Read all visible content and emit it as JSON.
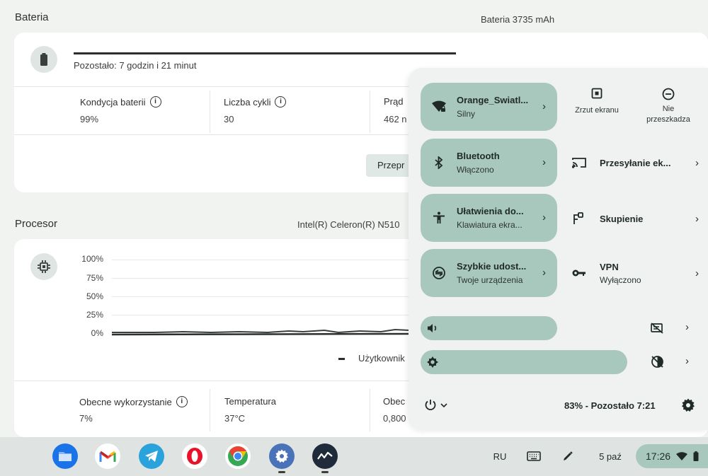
{
  "battery": {
    "title": "Bateria",
    "capacity": "Bateria 3735 mAh",
    "remaining": "Pozostało: 7 godzin i 21 minut",
    "health_label": "Kondycja baterii",
    "health_value": "99%",
    "cycles_label": "Liczba cykli",
    "cycles_value": "30",
    "current_label": "Prąd",
    "current_value": "462 n",
    "button_label": "Przepr"
  },
  "processor": {
    "title": "Procesor",
    "model": "Intel(R) Celeron(R) N510",
    "y_ticks": [
      "100%",
      "75%",
      "50%",
      "25%",
      "0%"
    ],
    "legend_user": "Użytkownik",
    "usage_label": "Obecne wykorzystanie",
    "usage_value": "7%",
    "temp_label": "Temperatura",
    "temp_value": "37°C",
    "freq_label": "Obec",
    "freq_value": "0,800"
  },
  "quick_settings": {
    "wifi": {
      "name": "Orange_Swiatl...",
      "status": "Silny"
    },
    "bluetooth": {
      "name": "Bluetooth",
      "status": "Włączono"
    },
    "accessibility": {
      "name": "Ułatwienia do...",
      "status": "Klawiatura ekra..."
    },
    "nearby": {
      "name": "Szybkie udost...",
      "status": "Twoje urządzenia"
    },
    "screenshot_label": "Zrzut ekranu",
    "dnd_label": "Nie przeszkadza",
    "cast_label": "Przesyłanie ek...",
    "focus_label": "Skupienie",
    "vpn": {
      "name": "VPN",
      "status": "Wyłączono"
    },
    "battery_status": "83% - Pozostało 7:21"
  },
  "shelf": {
    "apps": [
      "files",
      "gmail",
      "telegram",
      "opera",
      "chrome",
      "settings",
      "diagnostics"
    ],
    "ime": "RU",
    "date": "5 paź",
    "time": "17:26"
  }
}
